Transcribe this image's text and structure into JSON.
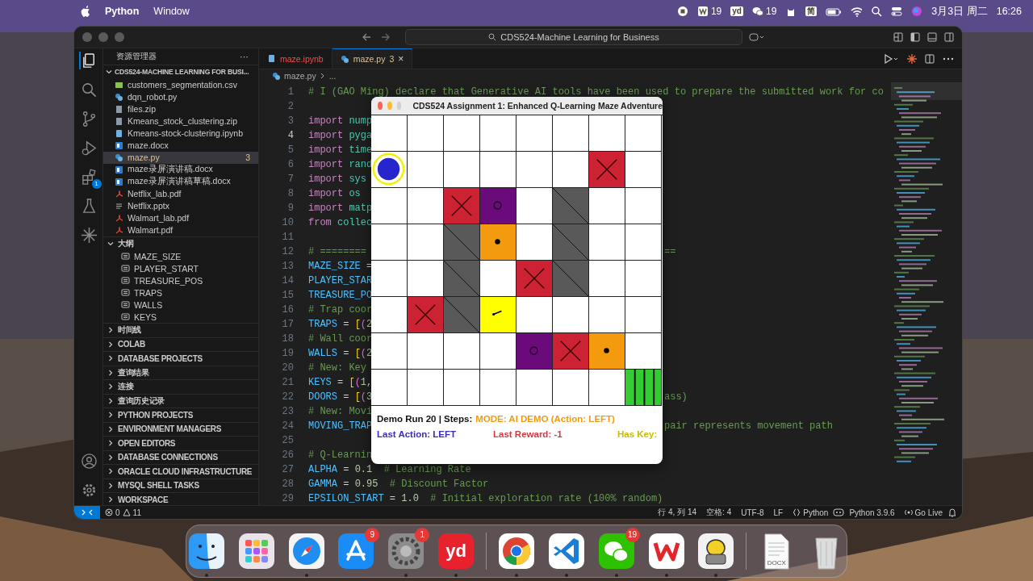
{
  "menu_bar": {
    "app": "Python",
    "menus": [
      "Window"
    ],
    "status_items": [
      {
        "kind": "record"
      },
      {
        "kind": "wps",
        "count": "19"
      },
      {
        "kind": "youdao",
        "glyph": "yd"
      },
      {
        "kind": "wechat",
        "count": "19"
      },
      {
        "kind": "cat"
      },
      {
        "kind": "ime",
        "glyph": "简"
      },
      {
        "kind": "battery"
      },
      {
        "kind": "wifi"
      },
      {
        "kind": "search"
      },
      {
        "kind": "control"
      },
      {
        "kind": "siri"
      }
    ],
    "date": "3月3日 周二",
    "time": "16:26"
  },
  "vscode": {
    "command_center": "CDS524-Machine Learning for Business",
    "activity_bar": [
      {
        "kind": "explorer",
        "selected": true
      },
      {
        "kind": "search",
        "selected": false
      },
      {
        "kind": "source-control",
        "selected": false
      },
      {
        "kind": "run-debug",
        "selected": false
      },
      {
        "kind": "extensions",
        "selected": false,
        "badge": "1"
      },
      {
        "kind": "testing",
        "selected": false
      },
      {
        "kind": "sparkle",
        "selected": false
      }
    ],
    "sidebar": {
      "title": "资源管理器",
      "more": "···",
      "folder": "CDS524-MACHINE LEARNING FOR BUSI...",
      "folder_expanded": true,
      "files": [
        {
          "name": "customers_segmentation.csv",
          "kind": "csv",
          "selected": false
        },
        {
          "name": "dqn_robot.py",
          "kind": "py",
          "selected": false
        },
        {
          "name": "files.zip",
          "kind": "zip",
          "selected": false
        },
        {
          "name": "Kmeans_stock_clustering.zip",
          "kind": "zip",
          "selected": false
        },
        {
          "name": "Kmeans-stock-clustering.ipynb",
          "kind": "ipynb",
          "selected": false
        },
        {
          "name": "maze.docx",
          "kind": "docx",
          "selected": false
        },
        {
          "name": "maze.py",
          "kind": "py",
          "selected": true,
          "badge": "3"
        },
        {
          "name": "maze录屏演讲稿.docx",
          "kind": "docx",
          "selected": false
        },
        {
          "name": "maze录屏演讲稿草稿.docx",
          "kind": "docx",
          "selected": false
        },
        {
          "name": "Netflix_lab.pdf",
          "kind": "pdf",
          "selected": false
        },
        {
          "name": "Netflix.pptx",
          "kind": "pptx",
          "selected": false
        },
        {
          "name": "Walmart_lab.pdf",
          "kind": "pdf",
          "selected": false
        },
        {
          "name": "Walmart.pdf",
          "kind": "pdf",
          "selected": false
        }
      ],
      "outline_title": "大纲",
      "outline_expanded": true,
      "outline": [
        "MAZE_SIZE",
        "PLAYER_START",
        "TREASURE_POS",
        "TRAPS",
        "WALLS",
        "KEYS"
      ],
      "sections": [
        {
          "title": "时间线",
          "expanded": false
        },
        {
          "title": "COLAB",
          "expanded": false
        },
        {
          "title": "DATABASE PROJECTS",
          "expanded": false
        },
        {
          "title": "查询结果",
          "expanded": false
        },
        {
          "title": "连接",
          "expanded": false
        },
        {
          "title": "查询历史记录",
          "expanded": false
        },
        {
          "title": "PYTHON PROJECTS",
          "expanded": false
        },
        {
          "title": "ENVIRONMENT MANAGERS",
          "expanded": false
        },
        {
          "title": "OPEN EDITORS",
          "expanded": false
        },
        {
          "title": "DATABASE CONNECTIONS",
          "expanded": false
        },
        {
          "title": "ORACLE CLOUD INFRASTRUCTURE",
          "expanded": false
        },
        {
          "title": "MYSQL SHELL TASKS",
          "expanded": false
        },
        {
          "title": "WORKSPACE",
          "expanded": false
        }
      ]
    },
    "tabs": [
      {
        "label": "maze.ipynb",
        "kind": "ipynb",
        "selected": false,
        "deleted": true
      },
      {
        "label": "maze.py",
        "kind": "py",
        "selected": true,
        "deleted": false,
        "badge": "3",
        "close": "×"
      }
    ],
    "breadcrumb": [
      "maze.py",
      "..."
    ],
    "code": [
      {
        "n": "1",
        "current": false,
        "tokens": [
          {
            "kind": "comment",
            "text": "# I (GAO Ming) declare that Generative AI tools have been used to prepare the submitted work for co"
          }
        ]
      },
      {
        "n": "2",
        "current": false
      },
      {
        "n": "3",
        "current": false,
        "tokens": [
          {
            "kind": "keyword",
            "text": "import "
          },
          {
            "kind": "module",
            "text": "nump"
          }
        ]
      },
      {
        "n": "4",
        "current": true,
        "tokens": [
          {
            "kind": "keyword",
            "text": "import "
          },
          {
            "kind": "module",
            "text": "pyga"
          }
        ]
      },
      {
        "n": "5",
        "current": false,
        "tokens": [
          {
            "kind": "keyword",
            "text": "import "
          },
          {
            "kind": "module",
            "text": "time"
          }
        ]
      },
      {
        "n": "6",
        "current": false,
        "tokens": [
          {
            "kind": "keyword",
            "text": "import "
          },
          {
            "kind": "module",
            "text": "rand"
          }
        ]
      },
      {
        "n": "7",
        "current": false,
        "tokens": [
          {
            "kind": "keyword",
            "text": "import "
          },
          {
            "kind": "module",
            "text": "sys"
          }
        ]
      },
      {
        "n": "8",
        "current": false,
        "tokens": [
          {
            "kind": "keyword",
            "text": "import "
          },
          {
            "kind": "module",
            "text": "os"
          }
        ]
      },
      {
        "n": "9",
        "current": false,
        "tokens": [
          {
            "kind": "keyword",
            "text": "import "
          },
          {
            "kind": "module",
            "text": "matp"
          }
        ]
      },
      {
        "n": "10",
        "current": false,
        "tokens": [
          {
            "kind": "keyword",
            "text": "from "
          },
          {
            "kind": "module",
            "text": "collec"
          }
        ]
      },
      {
        "n": "11",
        "current": false
      },
      {
        "n": "12",
        "current": false,
        "tokens": [
          {
            "kind": "comment",
            "text": "# ========"
          }
        ],
        "tail": [
          {
            "kind": "comment",
            "text": "=="
          }
        ]
      },
      {
        "n": "13",
        "current": false,
        "tokens": [
          {
            "kind": "constant",
            "text": "MAZE_SIZE"
          },
          {
            "kind": "operator",
            "text": " ="
          }
        ]
      },
      {
        "n": "14",
        "current": false,
        "tokens": [
          {
            "kind": "constant",
            "text": "PLAYER_STAR"
          }
        ]
      },
      {
        "n": "15",
        "current": false,
        "tokens": [
          {
            "kind": "constant",
            "text": "TREASURE_PO"
          }
        ]
      },
      {
        "n": "16",
        "current": false,
        "tokens": [
          {
            "kind": "comment",
            "text": "# Trap coor"
          }
        ]
      },
      {
        "n": "17",
        "current": false,
        "tokens": [
          {
            "kind": "constant",
            "text": "TRAPS"
          },
          {
            "kind": "operator",
            "text": " = "
          },
          {
            "kind": "bracket",
            "text": "["
          },
          {
            "kind": "paren",
            "text": "("
          },
          {
            "kind": "number",
            "text": "2"
          }
        ]
      },
      {
        "n": "18",
        "current": false,
        "tokens": [
          {
            "kind": "comment",
            "text": "# Wall coor"
          }
        ]
      },
      {
        "n": "19",
        "current": false,
        "tokens": [
          {
            "kind": "constant",
            "text": "WALLS"
          },
          {
            "kind": "operator",
            "text": " = "
          },
          {
            "kind": "bracket",
            "text": "["
          },
          {
            "kind": "paren",
            "text": "("
          },
          {
            "kind": "number",
            "text": "2"
          }
        ]
      },
      {
        "n": "20",
        "current": false,
        "tokens": [
          {
            "kind": "comment",
            "text": "# New: Key"
          }
        ]
      },
      {
        "n": "21",
        "current": false,
        "tokens": [
          {
            "kind": "constant",
            "text": "KEYS"
          },
          {
            "kind": "operator",
            "text": " = "
          },
          {
            "kind": "bracket",
            "text": "["
          },
          {
            "kind": "paren",
            "text": "("
          },
          {
            "kind": "number",
            "text": "1"
          },
          {
            "kind": "operator",
            "text": ","
          }
        ]
      },
      {
        "n": "22",
        "current": false,
        "tokens": [
          {
            "kind": "constant",
            "text": "DOORS"
          },
          {
            "kind": "operator",
            "text": " = "
          },
          {
            "kind": "bracket",
            "text": "["
          },
          {
            "kind": "paren",
            "text": "("
          },
          {
            "kind": "number",
            "text": "3"
          }
        ],
        "tail": [
          {
            "kind": "comment",
            "text": "ass)"
          }
        ]
      },
      {
        "n": "23",
        "current": false,
        "tokens": [
          {
            "kind": "comment",
            "text": "# New: Movi"
          }
        ]
      },
      {
        "n": "24",
        "current": false,
        "tokens": [
          {
            "kind": "constant",
            "text": "MOVING_TRAP"
          }
        ],
        "tail": [
          {
            "kind": "comment",
            "text": "pair represents movement path"
          }
        ]
      },
      {
        "n": "25",
        "current": false
      },
      {
        "n": "26",
        "current": false,
        "tokens": [
          {
            "kind": "comment",
            "text": "# Q-Learnin"
          }
        ]
      },
      {
        "n": "27",
        "current": false,
        "tokens": [
          {
            "kind": "constant",
            "text": "ALPHA"
          },
          {
            "kind": "operator",
            "text": " = "
          },
          {
            "kind": "number",
            "text": "0.1"
          },
          {
            "kind": "comment",
            "text": "  # Learning Rate"
          }
        ]
      },
      {
        "n": "28",
        "current": false,
        "tokens": [
          {
            "kind": "constant",
            "text": "GAMMA"
          },
          {
            "kind": "operator",
            "text": " = "
          },
          {
            "kind": "number",
            "text": "0.95"
          },
          {
            "kind": "comment",
            "text": "  # Discount Factor"
          }
        ]
      },
      {
        "n": "29",
        "current": false,
        "tokens": [
          {
            "kind": "constant",
            "text": "EPSILON_START"
          },
          {
            "kind": "operator",
            "text": " = "
          },
          {
            "kind": "number",
            "text": "1.0"
          },
          {
            "kind": "comment",
            "text": "  # Initial exploration rate (100% random)"
          }
        ]
      }
    ],
    "status_bar": {
      "errors": "0",
      "warnings": "11",
      "position": "行 4, 列 14",
      "indent": "空格: 4",
      "encoding": "UTF-8",
      "eol": "LF",
      "language": "Python",
      "interpreter": "Python 3.9.6",
      "live": "Go Live"
    }
  },
  "game_window": {
    "title": "CDS524 Assignment 1: Enhanced Q-Learning Maze Adventure",
    "grid": [
      [
        {
          "kind": "empty"
        },
        {
          "kind": "empty"
        },
        {
          "kind": "empty"
        },
        {
          "kind": "empty"
        },
        {
          "kind": "empty"
        },
        {
          "kind": "empty"
        },
        {
          "kind": "empty"
        },
        {
          "kind": "empty"
        }
      ],
      [
        {
          "kind": "player"
        },
        {
          "kind": "empty"
        },
        {
          "kind": "empty"
        },
        {
          "kind": "empty"
        },
        {
          "kind": "empty"
        },
        {
          "kind": "empty"
        },
        {
          "kind": "trap"
        },
        {
          "kind": "empty"
        }
      ],
      [
        {
          "kind": "empty"
        },
        {
          "kind": "empty"
        },
        {
          "kind": "trap"
        },
        {
          "kind": "moving"
        },
        {
          "kind": "empty"
        },
        {
          "kind": "wall"
        },
        {
          "kind": "empty"
        },
        {
          "kind": "empty"
        }
      ],
      [
        {
          "kind": "empty"
        },
        {
          "kind": "empty"
        },
        {
          "kind": "wall"
        },
        {
          "kind": "coin"
        },
        {
          "kind": "empty"
        },
        {
          "kind": "wall"
        },
        {
          "kind": "empty"
        },
        {
          "kind": "empty"
        }
      ],
      [
        {
          "kind": "empty"
        },
        {
          "kind": "empty"
        },
        {
          "kind": "wall"
        },
        {
          "kind": "empty"
        },
        {
          "kind": "trap"
        },
        {
          "kind": "wall"
        },
        {
          "kind": "empty"
        },
        {
          "kind": "empty"
        }
      ],
      [
        {
          "kind": "empty"
        },
        {
          "kind": "trap"
        },
        {
          "kind": "wall"
        },
        {
          "kind": "key"
        },
        {
          "kind": "empty"
        },
        {
          "kind": "empty"
        },
        {
          "kind": "empty"
        },
        {
          "kind": "empty"
        }
      ],
      [
        {
          "kind": "empty"
        },
        {
          "kind": "empty"
        },
        {
          "kind": "empty"
        },
        {
          "kind": "empty"
        },
        {
          "kind": "moving"
        },
        {
          "kind": "trap"
        },
        {
          "kind": "coin"
        },
        {
          "kind": "empty"
        }
      ],
      [
        {
          "kind": "empty"
        },
        {
          "kind": "empty"
        },
        {
          "kind": "empty"
        },
        {
          "kind": "empty"
        },
        {
          "kind": "empty"
        },
        {
          "kind": "empty"
        },
        {
          "kind": "empty"
        },
        {
          "kind": "treasure"
        }
      ]
    ],
    "run_info": "Demo Run 20 | Steps:",
    "mode_info": "MODE: AI DEMO (Action: LEFT)",
    "last_action": "Last Action: LEFT",
    "last_reward": "Last Reward: -1",
    "has_key": "Has Key:"
  },
  "dock": [
    {
      "kind": "finder",
      "running": true
    },
    {
      "kind": "launchpad",
      "running": false
    },
    {
      "kind": "safari",
      "running": true
    },
    {
      "kind": "appstore",
      "running": false,
      "badge": "9"
    },
    {
      "kind": "settings",
      "running": true,
      "badge": "1"
    },
    {
      "kind": "youdao",
      "running": true,
      "glyph": "yd"
    },
    {
      "kind": "separator"
    },
    {
      "kind": "chrome",
      "running": true
    },
    {
      "kind": "vscode",
      "running": true
    },
    {
      "kind": "wechat",
      "running": true,
      "badge": "19"
    },
    {
      "kind": "wps",
      "running": true
    },
    {
      "kind": "game",
      "running": true
    },
    {
      "kind": "separator"
    },
    {
      "kind": "document",
      "running": false,
      "label": "DOCX"
    },
    {
      "kind": "trash",
      "running": false
    }
  ]
}
